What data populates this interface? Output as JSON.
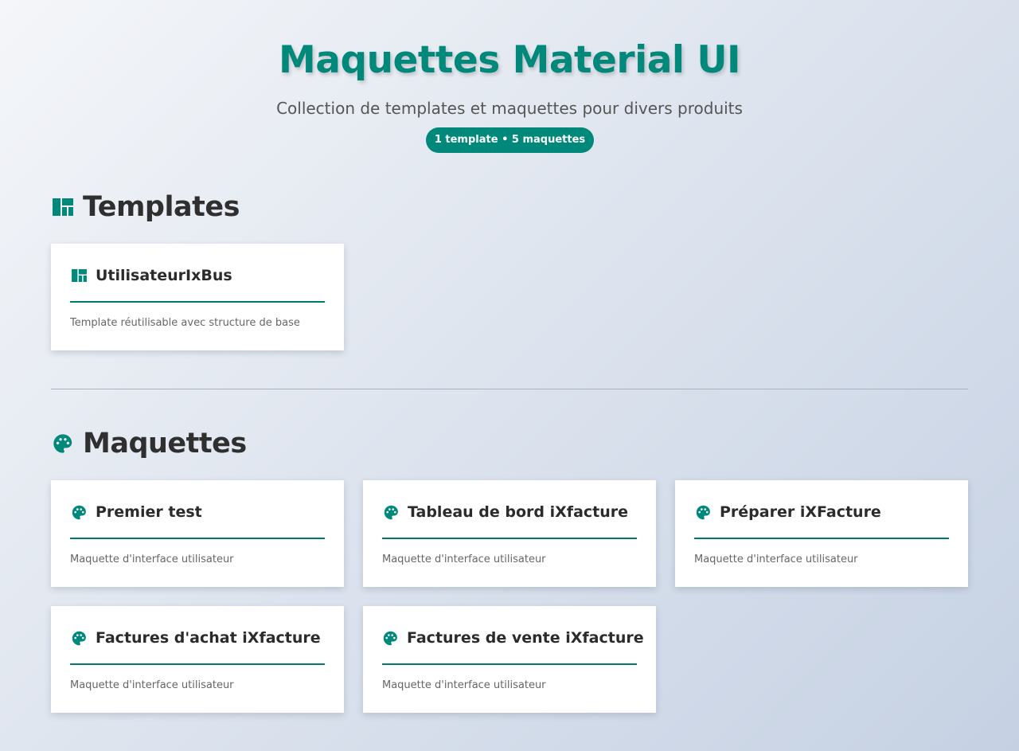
{
  "header": {
    "title": "Maquettes Material UI",
    "subtitle": "Collection de templates et maquettes pour divers produits",
    "badge": "1 template • 5 maquettes"
  },
  "colors": {
    "accent": "#00897b",
    "line": "#00796b"
  },
  "templates": {
    "heading": "Templates",
    "icon": "dashboard-icon",
    "items": [
      {
        "title": "UtilisateurIxBus",
        "description": "Template réutilisable avec structure de base",
        "icon": "dashboard-icon"
      }
    ]
  },
  "maquettes": {
    "heading": "Maquettes",
    "icon": "palette-icon",
    "items": [
      {
        "title": "Premier test",
        "description": "Maquette d'interface utilisateur",
        "icon": "palette-icon"
      },
      {
        "title": "Tableau de bord iXfacture",
        "description": "Maquette d'interface utilisateur",
        "icon": "palette-icon"
      },
      {
        "title": "Préparer iXFacture",
        "description": "Maquette d'interface utilisateur",
        "icon": "palette-icon"
      },
      {
        "title": "Factures d'achat iXfacture",
        "description": "Maquette d'interface utilisateur",
        "icon": "palette-icon"
      },
      {
        "title": "Factures de vente iXfacture",
        "description": "Maquette d'interface utilisateur",
        "icon": "palette-icon"
      }
    ]
  }
}
